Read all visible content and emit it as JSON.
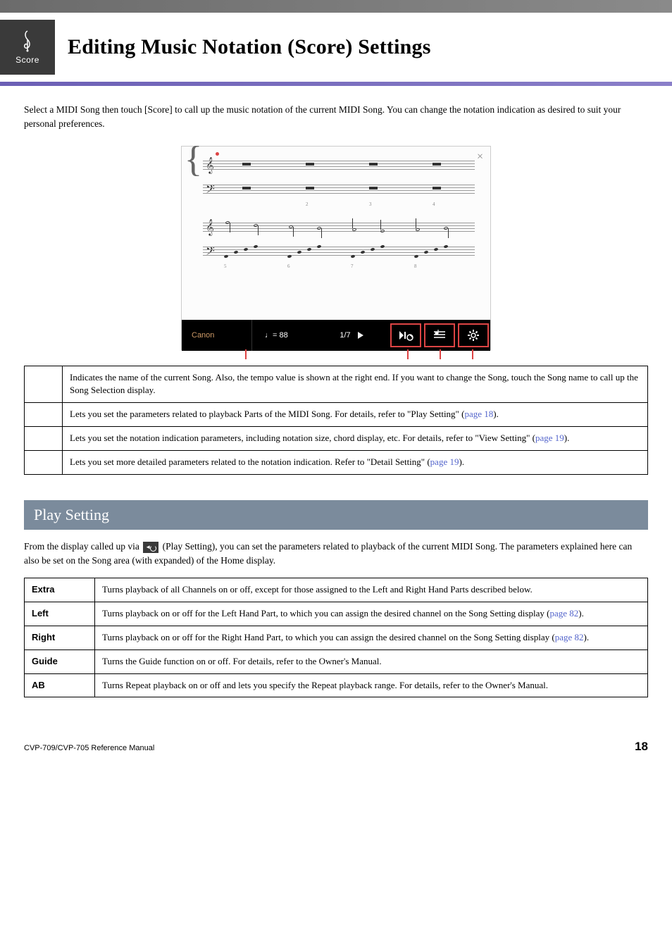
{
  "header": {
    "icon_label": "Score",
    "title": "Editing Music Notation (Score) Settings"
  },
  "intro": "Select a MIDI Song then touch [Score] to call up the music notation of the current MIDI Song. You can change the notation indication as desired to suit your personal preferences.",
  "screenshot": {
    "close_label": "×",
    "song_name": "Canon",
    "tempo": "♩= 88",
    "page_indicator": "1/7",
    "icons": {
      "play_setting": "play-setting-icon",
      "view_setting": "view-setting-icon",
      "detail_setting": "gear-icon"
    }
  },
  "info_rows": [
    {
      "desc": "Indicates the name of the current Song. Also, the tempo value is shown at the right end. If you want to change the Song, touch the Song name to call up the Song Selection display."
    },
    {
      "desc_pre": "Lets you set the parameters related to playback Parts of the MIDI Song. For details, refer to \"Play Setting\" (",
      "link": "page 18",
      "desc_post": ")."
    },
    {
      "desc_pre": "Lets you set the notation indication parameters, including notation size, chord display, etc. For details, refer to \"View Setting\" (",
      "link": "page 19",
      "desc_post": ")."
    },
    {
      "desc_pre": "Lets you set more detailed parameters related to the notation indication. Refer to \"Detail Setting\" (",
      "link": "page 19",
      "desc_post": ")."
    }
  ],
  "section": {
    "title": "Play Setting",
    "intro_pre": "From the display called up via ",
    "intro_post": " (Play Setting), you can set the parameters related to playback of the current MIDI Song. The parameters explained here can also be set on the Song area (with expanded) of the Home display."
  },
  "settings": [
    {
      "label": "Extra",
      "desc": "Turns playback of all Channels on or off, except for those assigned to the Left and Right Hand Parts described below."
    },
    {
      "label": "Left",
      "desc_pre": "Turns playback on or off for the Left Hand Part, to which you can assign the desired channel on the Song Setting display (",
      "link": "page 82",
      "desc_post": ")."
    },
    {
      "label": "Right",
      "desc_pre": "Turns playback on or off for the Right Hand Part, to which you can assign the desired channel on the Song Setting display (",
      "link": "page 82",
      "desc_post": ")."
    },
    {
      "label": "Guide",
      "desc": "Turns the Guide function on or off. For details, refer to the Owner's Manual."
    },
    {
      "label": "AB",
      "desc": "Turns Repeat playback on or off and lets you specify the Repeat playback range. For details, refer to the Owner's Manual."
    }
  ],
  "footer": {
    "ref": "CVP-709/CVP-705 Reference Manual",
    "page": "18"
  }
}
